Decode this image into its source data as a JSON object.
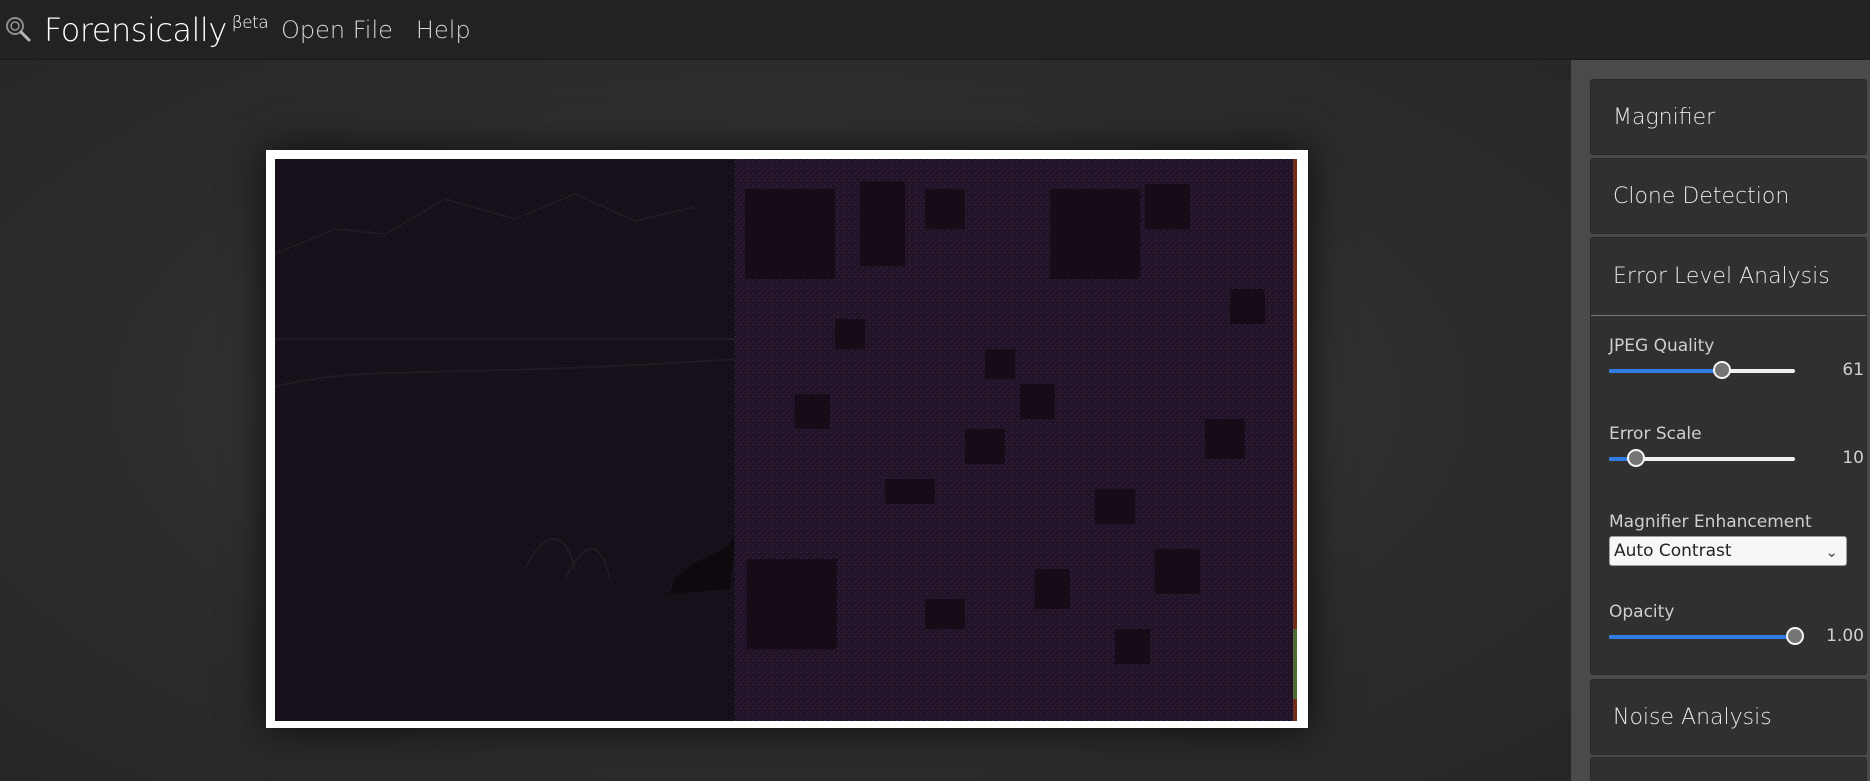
{
  "app": {
    "title": "Forensically",
    "title_suffix": "βeta",
    "icon": "magnifier-search-icon"
  },
  "nav": {
    "open_file": "Open File",
    "help": "Help"
  },
  "sidebar": {
    "panels": [
      {
        "label": "Magnifier"
      },
      {
        "label": "Clone Detection"
      },
      {
        "label": "Error Level Analysis"
      },
      {
        "label": "Noise Analysis"
      }
    ],
    "ela": {
      "jpeg_quality": {
        "label": "JPEG Quality",
        "value": "61",
        "fraction": 0.61
      },
      "error_scale": {
        "label": "Error Scale",
        "value": "10",
        "fraction": 0.145
      },
      "magnifier_enhancement": {
        "label": "Magnifier Enhancement",
        "selected": "Auto Contrast"
      },
      "opacity": {
        "label": "Opacity",
        "value": "1.00",
        "fraction": 1.0
      }
    }
  },
  "colors": {
    "accent": "#2f7de2",
    "topbar": "#222222",
    "sidebar": "#4a4a4a",
    "panel": "#303030"
  }
}
